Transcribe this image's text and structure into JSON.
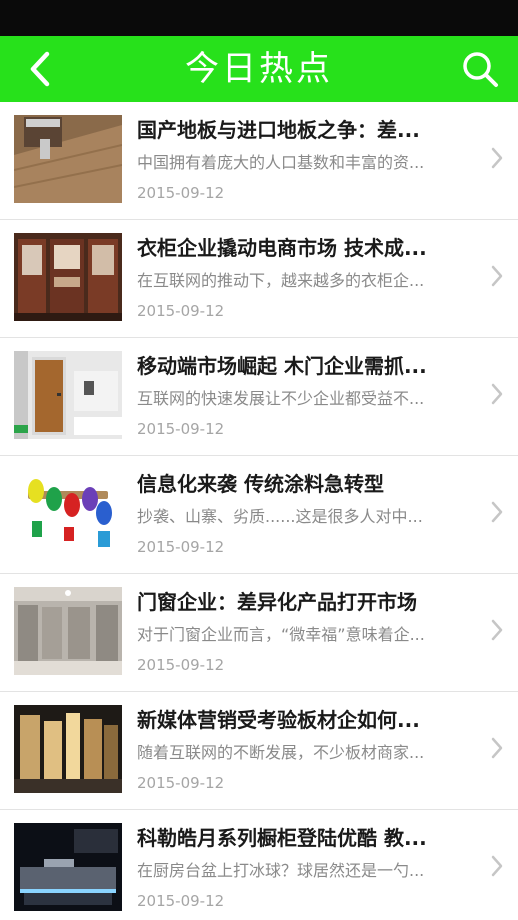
{
  "header": {
    "title": "今日热点",
    "back_icon": "chevron-left-icon",
    "search_icon": "search-icon",
    "background": "#27e11b"
  },
  "articles": [
    {
      "title": "国产地板与进口地板之争：差...",
      "summary": "中国拥有着庞大的人口基数和丰富的资...",
      "date": "2015-09-12"
    },
    {
      "title": "衣柜企业撬动电商市场 技术成...",
      "summary": "在互联网的推动下，越来越多的衣柜企...",
      "date": "2015-09-12"
    },
    {
      "title": "移动端市场崛起 木门企业需抓...",
      "summary": "互联网的快速发展让不少企业都受益不...",
      "date": "2015-09-12"
    },
    {
      "title": "信息化来袭 传统涂料急转型",
      "summary": "抄袭、山寨、劣质......这是很多人对中...",
      "date": "2015-09-12"
    },
    {
      "title": "门窗企业：差异化产品打开市场",
      "summary": "对于门窗企业而言，“微幸福”意味着企...",
      "date": "2015-09-12"
    },
    {
      "title": "新媒体营销受考验板材企如何...",
      "summary": "随着互联网的不断发展，不少板材商家...",
      "date": "2015-09-12"
    },
    {
      "title": "科勒皓月系列橱柜登陆优酷 教...",
      "summary": "在厨房台盆上打冰球？球居然还是一勺...",
      "date": "2015-09-12"
    }
  ]
}
